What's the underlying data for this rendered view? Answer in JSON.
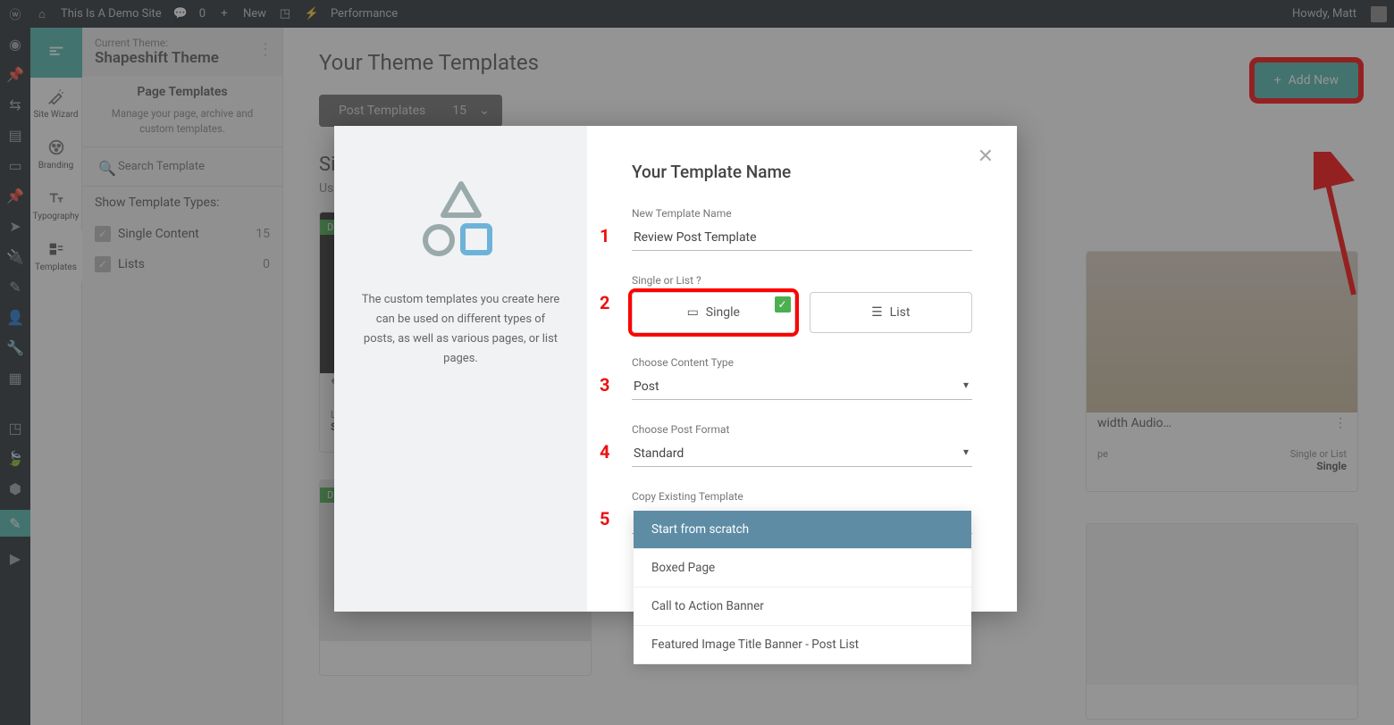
{
  "adminbar": {
    "site_name": "This Is A Demo Site",
    "comment_count": "0",
    "new_label": "New",
    "perf_label": "Performance",
    "howdy": "Howdy, Matt"
  },
  "app_side": {
    "wizard": "Site Wizard",
    "branding": "Branding",
    "typography": "Typography",
    "templates": "Templates"
  },
  "panel": {
    "current_theme_label": "Current Theme:",
    "theme_name": "Shapeshift Theme",
    "section_title": "Page Templates",
    "section_desc": "Manage your page, archive and custom templates.",
    "search_placeholder": "Search Template",
    "types_heading": "Show Template Types:",
    "types": [
      {
        "label": "Single Content",
        "count": "15"
      },
      {
        "label": "Lists",
        "count": "0"
      }
    ]
  },
  "main": {
    "heading": "Your Theme Templates",
    "dropdown_label": "Post Templates",
    "dropdown_count": "15",
    "add_new": "Add New",
    "section_h": "Si",
    "section_sub": "Us",
    "far_card_title": "width Audio…",
    "far_label_type": "pe",
    "far_label_sol": "Single or List",
    "far_value_sol": "Single",
    "badge_default": "D"
  },
  "modal": {
    "left_desc": "The custom templates you create here can be used on different types of posts, as well as various pages, or list pages.",
    "title": "Your Template Name",
    "f_name_label": "New Template Name",
    "f_name_value": "Review Post Template",
    "f_type_label": "Single or List ?",
    "opt_single": "Single",
    "opt_list": "List",
    "f_content_label": "Choose Content Type",
    "f_content_value": "Post",
    "f_format_label": "Choose Post Format",
    "f_format_value": "Standard",
    "f_copy_label": "Copy Existing Template",
    "f_copy_value": "Start from scratch",
    "steps": {
      "1": "1",
      "2": "2",
      "3": "3",
      "4": "4",
      "5": "5"
    }
  },
  "dropdown": {
    "options": [
      "Start from scratch",
      "Boxed Page",
      "Call to Action Banner",
      "Featured Image Title Banner - Post List"
    ]
  }
}
